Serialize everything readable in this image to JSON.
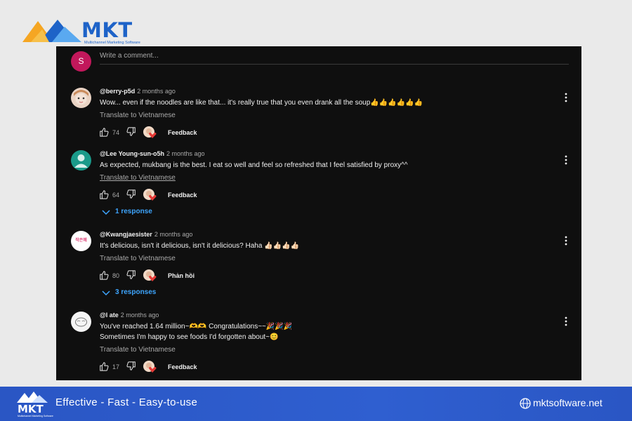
{
  "brand": {
    "name": "MKT",
    "subtitle": "Multichannel Marketing Software",
    "tagline": "Effective - Fast - Easy-to-use",
    "website": "mktsoftware.net",
    "colors": {
      "primary": "#1e63c8",
      "accent": "#f5a623",
      "footer_bg": "#2f5fd0"
    }
  },
  "comment_box": {
    "avatar_letter": "S",
    "placeholder": "Write a comment..."
  },
  "comments": [
    {
      "author": "@berry-p5d",
      "time": "2 months ago",
      "text": "Wow... even if the noodles are like that... it's really true that you even drank all the soup",
      "emojis": "👍👍👍👍👍👍",
      "translate": "Translate to Vietnamese",
      "likes": "74",
      "feedback": "Feedback"
    },
    {
      "author": "@Lee Young-sun-o5h",
      "time": "2 months ago",
      "text": "As expected, mukbang is the best. I eat so well and feel so refreshed that I feel satisfied by proxy^^",
      "translate": "Translate to Vietnamese",
      "likes": "64",
      "feedback": "Feedback",
      "responses": "1 response"
    },
    {
      "author": "@Kwangjaesister",
      "time": "2 months ago",
      "text": "It's delicious, isn't it delicious, isn't it delicious? Haha",
      "emojis": "👍🏻👍🏻👍🏻👍🏻",
      "translate": "Translate to Vietnamese",
      "likes": "80",
      "feedback": "Phản hồi",
      "responses": "3 responses",
      "avatar_text": "작은혜"
    },
    {
      "author": "@l ate",
      "time": "2 months ago",
      "text": "You've reached 1.64 million~",
      "emojis": "🫶🫶",
      "text_b": "Congratulations~~",
      "emojis_b": "🎉🎉🎉",
      "text2": "Sometimes I'm happy to see foods I'd forgotten about~",
      "emojis2": "😊",
      "translate": "Translate to Vietnamese",
      "likes": "17",
      "feedback": "Feedback"
    }
  ]
}
